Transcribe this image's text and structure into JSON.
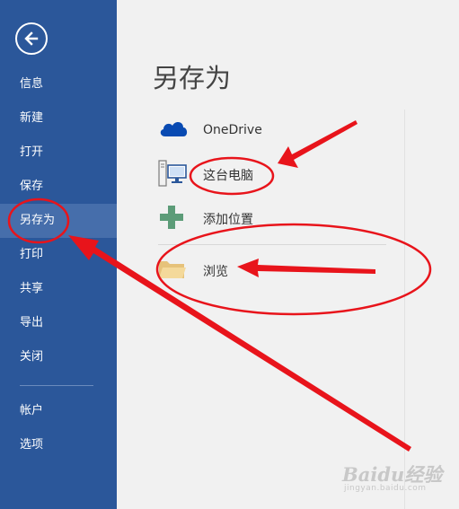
{
  "sidebar": {
    "items": [
      {
        "label": "信息"
      },
      {
        "label": "新建"
      },
      {
        "label": "打开"
      },
      {
        "label": "保存"
      },
      {
        "label": "另存为",
        "active": true
      },
      {
        "label": "打印"
      },
      {
        "label": "共享"
      },
      {
        "label": "导出"
      },
      {
        "label": "关闭"
      },
      {
        "label": "帐户"
      },
      {
        "label": "选项"
      }
    ]
  },
  "main": {
    "title": "另存为",
    "locations": [
      {
        "label": "OneDrive",
        "icon": "onedrive-cloud-icon"
      },
      {
        "label": "这台电脑",
        "icon": "this-pc-icon"
      },
      {
        "label": "添加位置",
        "icon": "add-place-icon"
      },
      {
        "label": "浏览",
        "icon": "browse-folder-icon"
      }
    ]
  },
  "watermark": {
    "text": "Baidu经验",
    "sub": "jingyan.baidu.com"
  },
  "colors": {
    "sidebar_bg": "#2b579a",
    "sidebar_active": "#466eab",
    "annotation_red": "#e8141b",
    "onedrive_blue": "#094ab2",
    "add_green": "#5c9c78"
  }
}
